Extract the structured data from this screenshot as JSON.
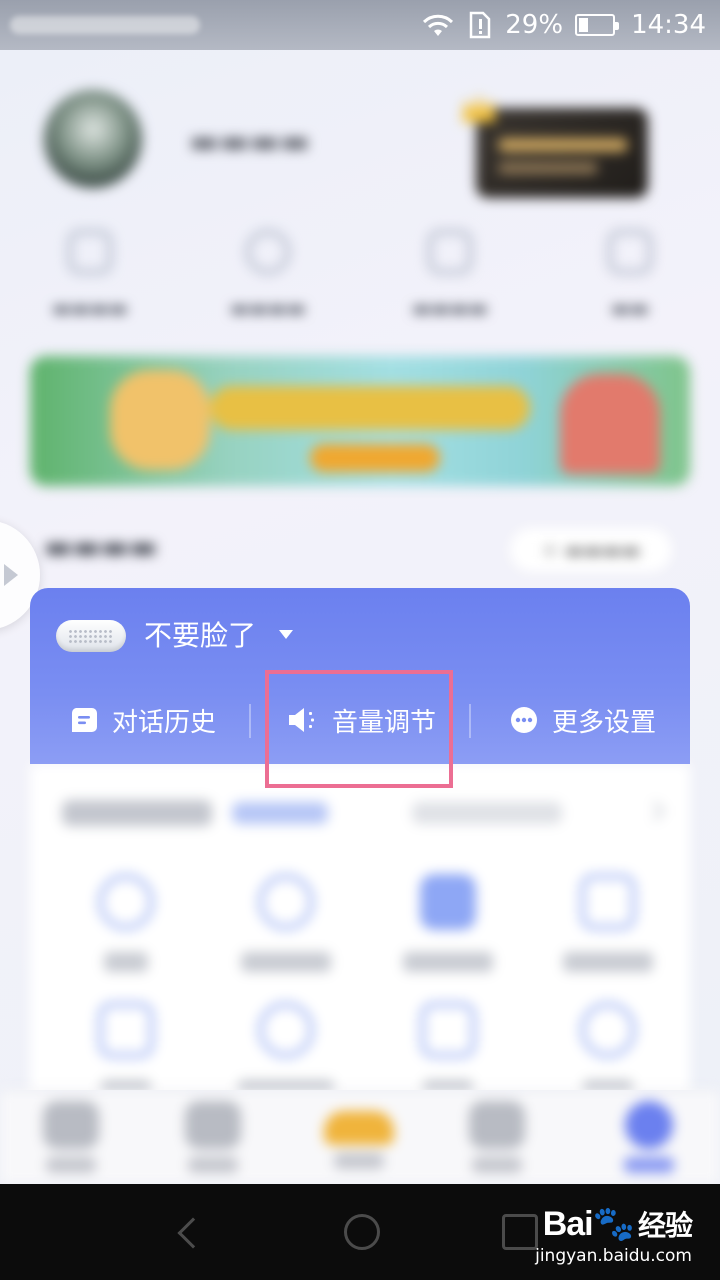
{
  "status_bar": {
    "battery_percent": "29%",
    "battery_level": 0.29,
    "time": "14:34",
    "icons": [
      "wifi-icon",
      "sim-alert-icon",
      "battery-icon"
    ]
  },
  "device_card": {
    "device_name": "不要脸了",
    "actions": [
      {
        "label": "对话历史",
        "icon": "chat-history-icon"
      },
      {
        "label": "音量调节",
        "icon": "volume-icon"
      },
      {
        "label": "更多设置",
        "icon": "more-icon"
      }
    ],
    "accent_color": "#6b80ef",
    "highlight_color": "#ec6e93"
  },
  "watermark": {
    "brand": "Bai",
    "brand_suffix": "经验",
    "url": "jingyan.baidu.com"
  }
}
